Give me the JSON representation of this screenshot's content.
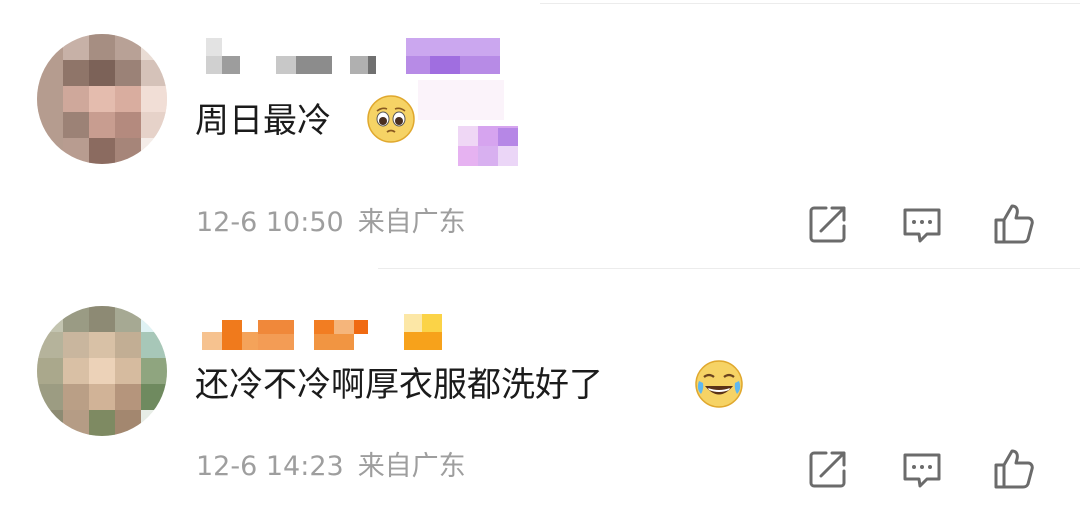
{
  "comments": [
    {
      "text": "周日最冷",
      "emoji": "pleading-face-emoji",
      "date": "12-6",
      "time": "10:50",
      "location": "来自广东",
      "actions": {
        "share_icon": "share-icon",
        "reply_icon": "comment-icon",
        "like_icon": "thumbs-up-icon"
      }
    },
    {
      "text": "还冷不冷啊厚衣服都洗好了",
      "emoji": "rolling-on-floor-laughing-emoji",
      "date": "12-6",
      "time": "14:23",
      "location": "来自广东",
      "actions": {
        "share_icon": "share-icon",
        "reply_icon": "comment-icon",
        "like_icon": "thumbs-up-icon"
      }
    }
  ],
  "colors": {
    "text": "#1b1b1b",
    "meta": "#9e9e9e",
    "icon": "#6b6b6b",
    "separator": "#ececec"
  }
}
